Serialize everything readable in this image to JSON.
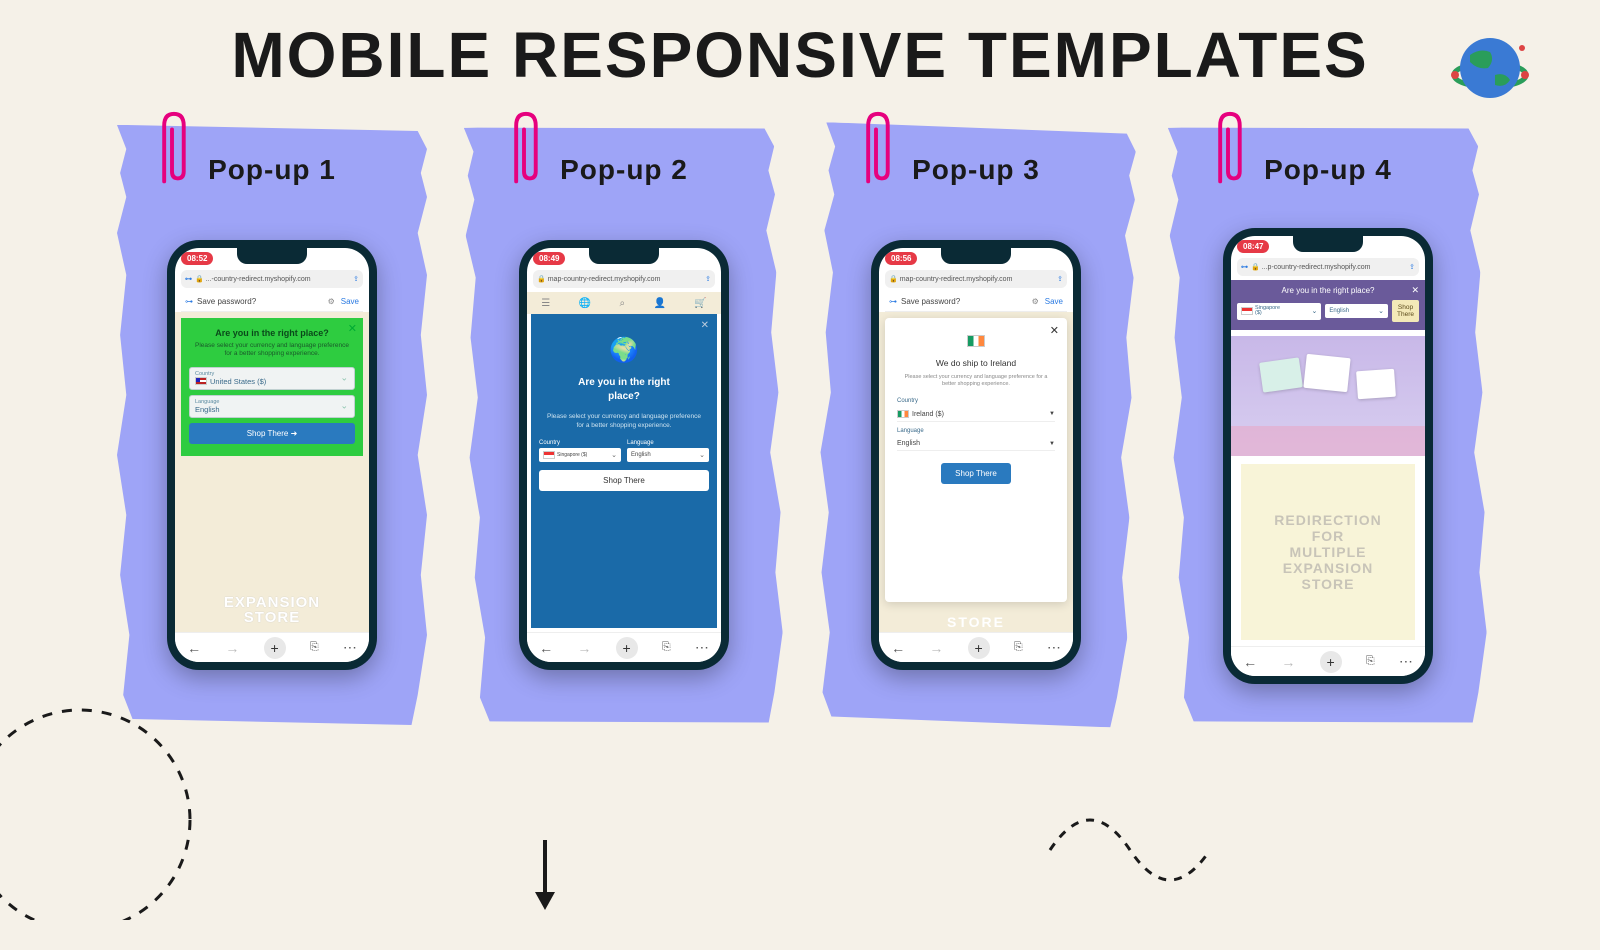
{
  "title": "MOBILE RESPONSIVE TEMPLATES",
  "cards": [
    {
      "label": "Pop-up 1",
      "time": "08:52",
      "url": "...-country-redirect.myshopify.com",
      "save_password": "Save password?",
      "save": "Save",
      "heading": "Are you in the right place?",
      "sub": "Please select your currency and language preference for a better shopping experience.",
      "country_label": "Country",
      "country_value": "United States ($)",
      "language_label": "Language",
      "language_value": "English",
      "button": "Shop There  ➜",
      "footer": "EXPANSION STORE"
    },
    {
      "label": "Pop-up 2",
      "time": "08:49",
      "url": "map-country-redirect.myshopify.com",
      "heading": "Are you in the right place?",
      "sub": "Please select your currency and language preference for a better shopping experience.",
      "country_label": "Country",
      "country_value": "Singapore ($)",
      "language_label": "Language",
      "language_value": "English",
      "button": "Shop There"
    },
    {
      "label": "Pop-up 3",
      "time": "08:56",
      "url": "map-country-redirect.myshopify.com",
      "save_password": "Save password?",
      "save": "Save",
      "heading": "We do ship to Ireland",
      "sub": "Please select your currency and language preference for a better shopping experience.",
      "country_label": "Country",
      "country_value": "Ireland ($)",
      "language_label": "Language",
      "language_value": "English",
      "button": "Shop There",
      "footer": "STORE"
    },
    {
      "label": "Pop-up 4",
      "time": "08:47",
      "url": "...p-country-redirect.myshopify.com",
      "heading": "Are you in the right place?",
      "country_value": "Singapore ($)",
      "language_value": "English",
      "button": "Shop There",
      "redir": "REDIRECTION FOR MULTIPLE EXPANSION STORE"
    }
  ]
}
